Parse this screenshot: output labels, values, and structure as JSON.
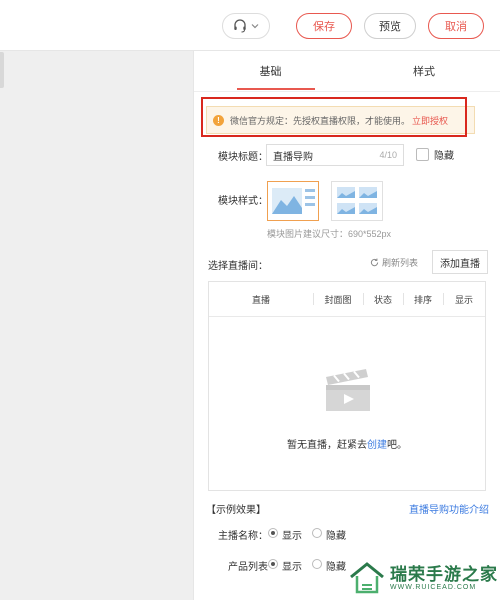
{
  "toolbar": {
    "save_label": "保存",
    "preview_label": "预览",
    "cancel_label": "取消"
  },
  "tabs": [
    {
      "label": "基础",
      "active": true
    },
    {
      "label": "样式",
      "active": false
    }
  ],
  "notice": {
    "text": "微信官方规定：先授权直播权限，才能使用。",
    "link": "立即授权"
  },
  "form": {
    "title_label": "模块标题：",
    "title_value": "直播导购",
    "title_count": "4/10",
    "hide_label": "隐藏",
    "style_label": "模块样式：",
    "style_hint": "模块图片建议尺寸：690*552px",
    "select_label": "选择直播间：",
    "refresh_label": "刷新列表",
    "add_label": "添加直播"
  },
  "table": {
    "columns": [
      "直播",
      "封面图",
      "状态",
      "排序",
      "显示"
    ],
    "empty_text": "暂无直播，赶紧去",
    "empty_link": "创建",
    "empty_suffix": "吧。"
  },
  "example": {
    "heading": "【示例效果】",
    "intro_link": "直播导购功能介绍",
    "rows": [
      {
        "label": "主播名称：",
        "options": [
          "显示",
          "隐藏"
        ],
        "selected": 0
      },
      {
        "label": "产品列表",
        "options": [
          "显示",
          "隐藏"
        ],
        "selected": 0
      }
    ]
  },
  "watermark": {
    "title": "瑞荣手游之家",
    "url": "WWW.RUICEAD.COM"
  },
  "colors": {
    "accent": "#e8584f",
    "link": "#3c7be0",
    "notice_bg": "#fdf5e8",
    "highlight_box": "#d9281e"
  }
}
